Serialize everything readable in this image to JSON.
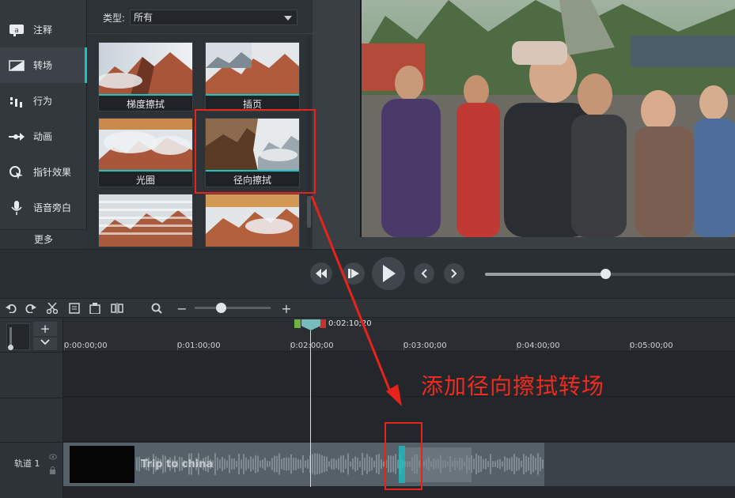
{
  "sidebar": {
    "items": [
      {
        "label": "注释",
        "icon": "annotation-icon"
      },
      {
        "label": "转场",
        "icon": "transition-icon"
      },
      {
        "label": "行为",
        "icon": "behavior-icon"
      },
      {
        "label": "动画",
        "icon": "animation-icon"
      },
      {
        "label": "指针效果",
        "icon": "cursor-effect-icon"
      },
      {
        "label": "语音旁白",
        "icon": "microphone-icon"
      }
    ],
    "more_label": "更多"
  },
  "library": {
    "type_label": "类型:",
    "type_value": "所有",
    "thumbnails": [
      {
        "label": "梯度擦拭"
      },
      {
        "label": "插页"
      },
      {
        "label": "光圈"
      },
      {
        "label": "径向擦拭"
      },
      {
        "label": ""
      },
      {
        "label": ""
      }
    ]
  },
  "timeline": {
    "playhead_time": "0:02:10;20",
    "ticks": [
      "0:00:00;00",
      "0:01:00;00",
      "0:02:00;00",
      "0:03:00;00",
      "0:04:00;00",
      "0:05:00;00"
    ],
    "track_label": "轨道 1",
    "clip_title": "Trip to china"
  },
  "annotation": {
    "text": "添加径向擦拭转场"
  },
  "colors": {
    "accent": "#17c5c3",
    "annotation_red": "#e8231c"
  }
}
